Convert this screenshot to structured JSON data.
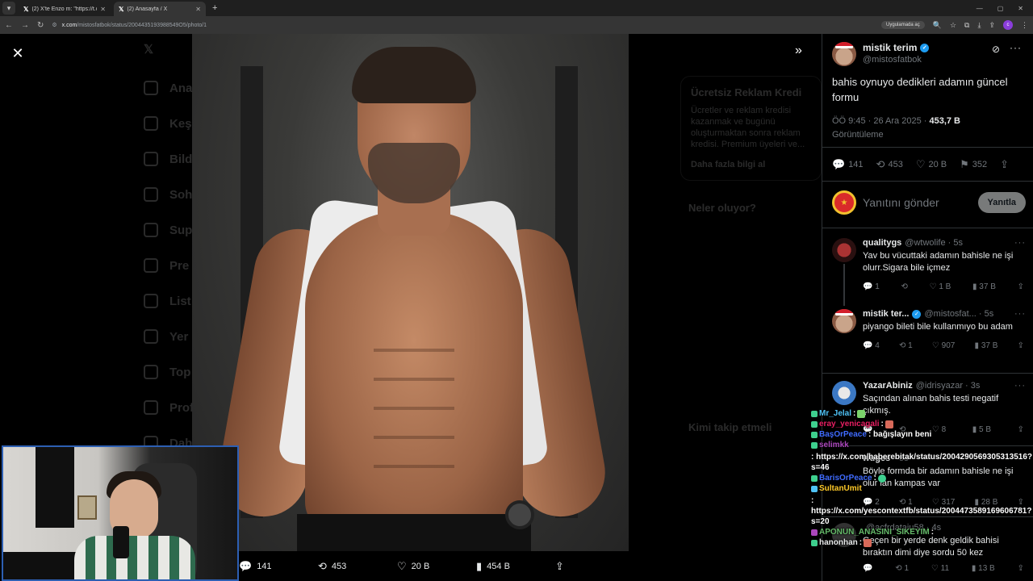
{
  "browser": {
    "tabs": [
      {
        "title": "(2) X'te Enzo m: \"https://t.co/c...",
        "active": false
      },
      {
        "title": "(2) Anasayfa / X",
        "active": true
      }
    ],
    "url_host": "x.com",
    "url_path": "/mistosfatbok/status/2004435193988549O5/photo/1",
    "app_pill": "Uygulamada aç",
    "profile_letter": "c"
  },
  "background": {
    "nav": [
      "Ana",
      "Keş",
      "Bild",
      "Soh",
      "Sup",
      "Pre",
      "List",
      "Yer",
      "Top",
      "Prof",
      "Daha"
    ],
    "card_title": "Ücretsiz Reklam Kredi",
    "card_text": "Ücretler ve reklam kredisi kazanmak ve bugünü oluşturmaktan sonra reklam kredisi. Premium üyeleri ve...",
    "card_link": "Daha fazla bilgi al",
    "whats_happening": "Neler oluyor?",
    "who_to_follow": "Kimi takip etmeli"
  },
  "photo_actions": {
    "replies": "141",
    "reposts": "453",
    "likes": "20 B",
    "views": "454 B"
  },
  "tweet": {
    "author_name": "mistik terim",
    "author_handle": "@mistosfatbok",
    "text": "bahis oynuyo dedikleri adamın güncel formu",
    "time": "ÖÖ 9:45 · 26 Ara 2025 · ",
    "views": "453,7 B",
    "views_label": "Görüntüleme",
    "stats": {
      "replies": "141",
      "reposts": "453",
      "likes": "20 B",
      "bookmarks": "352"
    }
  },
  "reply_box": {
    "placeholder": "Yanıtını gönder",
    "button": "Yanıtla"
  },
  "replies": [
    {
      "name": "qualitygs",
      "handle": "@wtwolife · 5s",
      "text": "Yav bu vücuttaki adamın bahisle ne işi olurr.Sigara bile içmez",
      "stats": {
        "replies": "1",
        "reposts": "",
        "likes": "1 B",
        "views": "37 B"
      }
    },
    {
      "name": "mistik ter...",
      "handle": "@mistosfat... · 5s",
      "text": "piyango bileti bile kullanmıyo bu adam",
      "stats": {
        "replies": "4",
        "reposts": "1",
        "likes": "907",
        "views": "37 B"
      }
    },
    {
      "name": "YazarAbiniz",
      "handle": "@idrisyazar · 3s",
      "text": "Saçından alınan bahis testi negatif çıkmış.",
      "stats": {
        "replies": "",
        "reposts": "",
        "likes": "8",
        "views": "5 B"
      }
    },
    {
      "name": "wuges",
      "handle": "· 5s",
      "text": "Böyle formda bir adamın bahisle ne işi olur lan kampas var",
      "stats": {
        "replies": "2",
        "reposts": "1",
        "likes": "317",
        "views": "28 B"
      }
    },
    {
      "name": "",
      "handle": "@acfrdataiu58 · 4s",
      "text": "Geçen bir yerde denk geldik bahisi bıraktın dimi diye sordu 50 kez",
      "stats": {
        "replies": "",
        "reposts": "1",
        "likes": "11",
        "views": "13 B"
      }
    }
  ],
  "chat": [
    {
      "user": "Mr_Jelal",
      "color": "#4fc3f7",
      "msg": ""
    },
    {
      "user": "eray_yenicagali",
      "color": "#e91e63",
      "msg": ""
    },
    {
      "user": "BaşOrPeace",
      "color": "#3f6bff",
      "msg": ": bağışlayın beni"
    },
    {
      "user": "selimkk",
      "color": "#ab47bc",
      "msg": ": https://x.com/haberebitak/status/2004290569305313516?s=46"
    },
    {
      "user": "BarisOrPeace",
      "color": "#3f6bff",
      "msg": ":"
    },
    {
      "user": "SultanUmit",
      "color": "#ffca28",
      "msg": ": https://x.com/yescontextfb/status/2004473589169606781?s=20"
    },
    {
      "user": "APONUN_ANASINI_SIKEYIM",
      "color": "#66bb6a",
      "msg": ":"
    },
    {
      "user": "hanonhan",
      "color": "#e7e9ea",
      "msg": ":"
    }
  ]
}
